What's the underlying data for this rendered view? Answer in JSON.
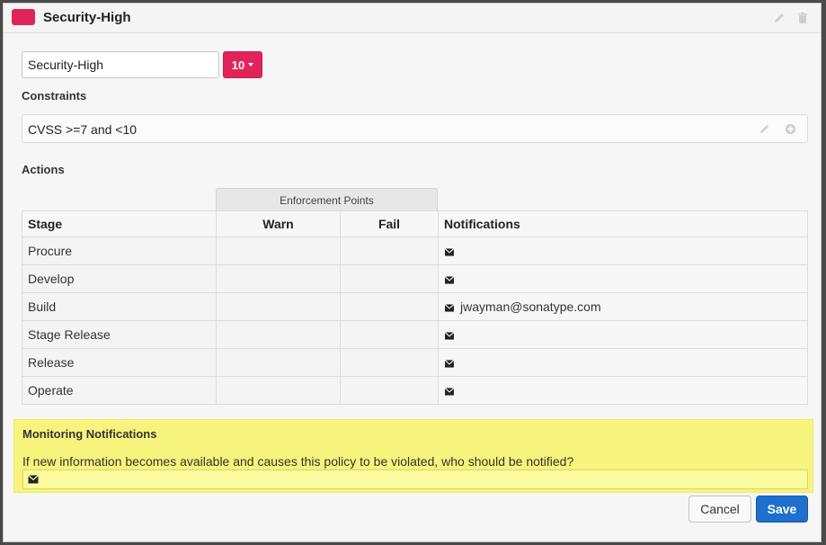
{
  "header": {
    "title": "Security-High",
    "color": "#e0245a",
    "icons": [
      "pencil-icon",
      "trash-icon"
    ]
  },
  "policy": {
    "name_value": "Security-High",
    "threat_level": "10",
    "threat_color": "#e0245a"
  },
  "constraints": {
    "label": "Constraints",
    "items": [
      {
        "text": "CVSS >=7 and <10",
        "icons": [
          "pencil-icon",
          "plus-circle-icon"
        ]
      }
    ]
  },
  "actions": {
    "label": "Actions",
    "enforcement_header": "Enforcement Points",
    "columns": [
      "Stage",
      "Warn",
      "Fail",
      "Notifications"
    ],
    "rows": [
      {
        "stage": "Procure",
        "notification": ""
      },
      {
        "stage": "Develop",
        "notification": ""
      },
      {
        "stage": "Build",
        "notification": "jwayman@sonatype.com"
      },
      {
        "stage": "Stage Release",
        "notification": ""
      },
      {
        "stage": "Release",
        "notification": ""
      },
      {
        "stage": "Operate",
        "notification": ""
      }
    ]
  },
  "monitoring": {
    "title": "Monitoring Notifications",
    "question": "If new information becomes available and causes this policy to be violated, who should be notified?",
    "background": "#f6f47c"
  },
  "buttons": {
    "cancel": "Cancel",
    "save": "Save",
    "save_color": "#1e6fce"
  }
}
